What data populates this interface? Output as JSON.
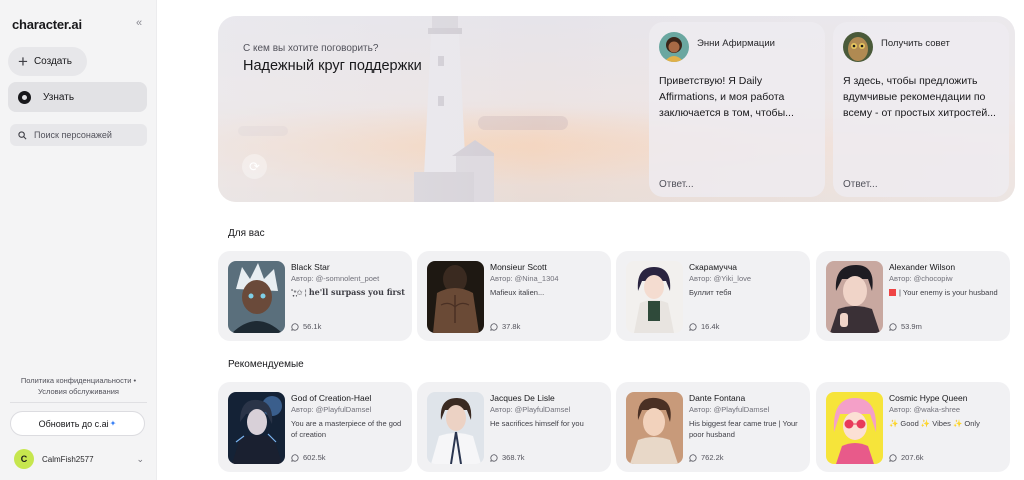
{
  "sidebar": {
    "logo": "character.ai",
    "collapse_icon": "«",
    "create_label": "Создать",
    "discover_label": "Узнать",
    "search_placeholder": "Поиск персонажей",
    "privacy": "Политика конфиденциальности",
    "terms": "Условия обслуживания",
    "upgrade_label": "Обновить до c.ai",
    "user": {
      "initial": "C",
      "name": "CalmFish2577"
    }
  },
  "hero": {
    "subtitle": "С кем вы хотите поговорить?",
    "title": "Надежный круг поддержки",
    "cards": [
      {
        "name": "Энни Афирмации",
        "text": "Приветствую! Я Daily Affirmations, и моя работа заключается в том, чтобы...",
        "reply": "Ответ..."
      },
      {
        "name": "Получить совет",
        "text": "Я здесь, чтобы предложить вдумчивые рекомендации по всему - от простых хитростей...",
        "reply": "Ответ..."
      }
    ]
  },
  "for_you": {
    "title": "Для вас",
    "cards": [
      {
        "name": "Black Star",
        "author": "Автор: @-somnolent_poet",
        "desc_prefix": "˚̩̥̩̥*̩̩͙✩ ¦ ",
        "desc": "he'll surpass you first",
        "count": "56.1k"
      },
      {
        "name": "Monsieur Scott",
        "author": "Автор: @Nina_1304",
        "desc": "Mafieux italien...",
        "count": "37.8k"
      },
      {
        "name": "Скарамучча",
        "author": "Автор: @Yiki_love",
        "desc": "Буллит тебя",
        "count": "16.4k"
      },
      {
        "name": "Alexander Wilson",
        "author": "Автор: @chocopiw",
        "desc": "| Your enemy is your husband",
        "count": "53.9m"
      }
    ]
  },
  "recommended": {
    "title": "Рекомендуемые",
    "cards": [
      {
        "name": "God of Creation-Hael",
        "author": "Автор: @PlayfulDamsel",
        "desc": "You are a masterpiece of the god of creation",
        "count": "602.5k"
      },
      {
        "name": "Jacques De Lisle",
        "author": "Автор: @PlayfulDamsel",
        "desc": "He sacrifices himself for you",
        "count": "368.7k"
      },
      {
        "name": "Dante Fontana",
        "author": "Автор: @PlayfulDamsel",
        "desc": "His biggest fear came true | Your poor husband",
        "count": "762.2k"
      },
      {
        "name": "Cosmic Hype Queen",
        "author": "Автор: @waka-shree",
        "desc": "✨ Good ✨ Vibes ✨ Only",
        "count": "207.6k"
      }
    ]
  }
}
